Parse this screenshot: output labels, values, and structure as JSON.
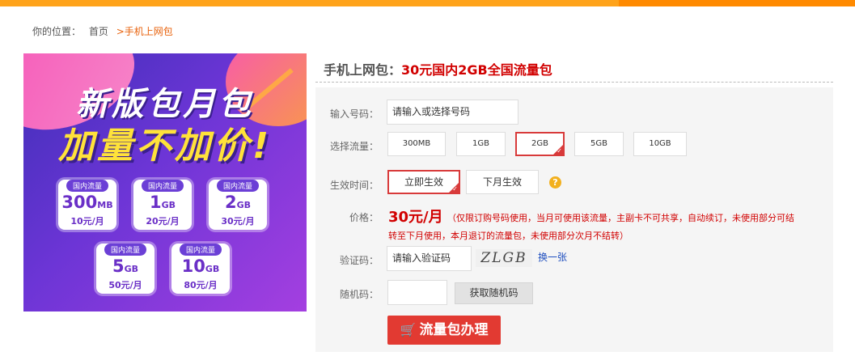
{
  "breadcrumb": {
    "prefix": "你的位置：",
    "home": "首页",
    "current": ">手机上网包"
  },
  "banner": {
    "headline1": "新版包月包",
    "headline2": "加量不加价!",
    "cards": [
      {
        "tag": "国内流量",
        "amount": "300",
        "unit": "MB",
        "price": "10元/月"
      },
      {
        "tag": "国内流量",
        "amount": "1",
        "unit": "GB",
        "price": "20元/月"
      },
      {
        "tag": "国内流量",
        "amount": "2",
        "unit": "GB",
        "price": "30元/月"
      },
      {
        "tag": "国内流量",
        "amount": "5",
        "unit": "GB",
        "price": "50元/月"
      },
      {
        "tag": "国内流量",
        "amount": "10",
        "unit": "GB",
        "price": "80元/月"
      }
    ]
  },
  "product": {
    "category": "手机上网包：",
    "name": "30元国内2GB全国流量包"
  },
  "form": {
    "phone_label": "输入号码：",
    "phone_placeholder": "请输入或选择号码",
    "plan_label": "选择流量：",
    "plans": [
      "300MB",
      "1GB",
      "2GB",
      "5GB",
      "10GB"
    ],
    "selected_plan": "2GB",
    "effect_label": "生效时间：",
    "effect_options": [
      "立即生效",
      "下月生效"
    ],
    "selected_effect": "立即生效",
    "help_icon": "?",
    "price_label": "价格：",
    "price": "30元/月",
    "price_note_line1": "（仅限订购号码使用，当月可使用该流量，主副卡不可共享，自动续订，未使用部分可结",
    "price_note_line2": "转至下月使用，本月退订的流量包，未使用部分次月不结转）",
    "captcha_label": "验证码：",
    "captcha_placeholder": "请输入验证码",
    "captcha_text": "ZLGB",
    "captcha_refresh": "换一张",
    "random_label": "随机码：",
    "random_value": "",
    "get_random_button": "获取随机码",
    "submit_icon": "🛒",
    "submit_button": "流量包办理"
  },
  "colors": {
    "accent_orange": "#ff8a00",
    "price_red": "#d10000",
    "submit_red": "#e23a32",
    "link_blue": "#1f4fbf"
  }
}
